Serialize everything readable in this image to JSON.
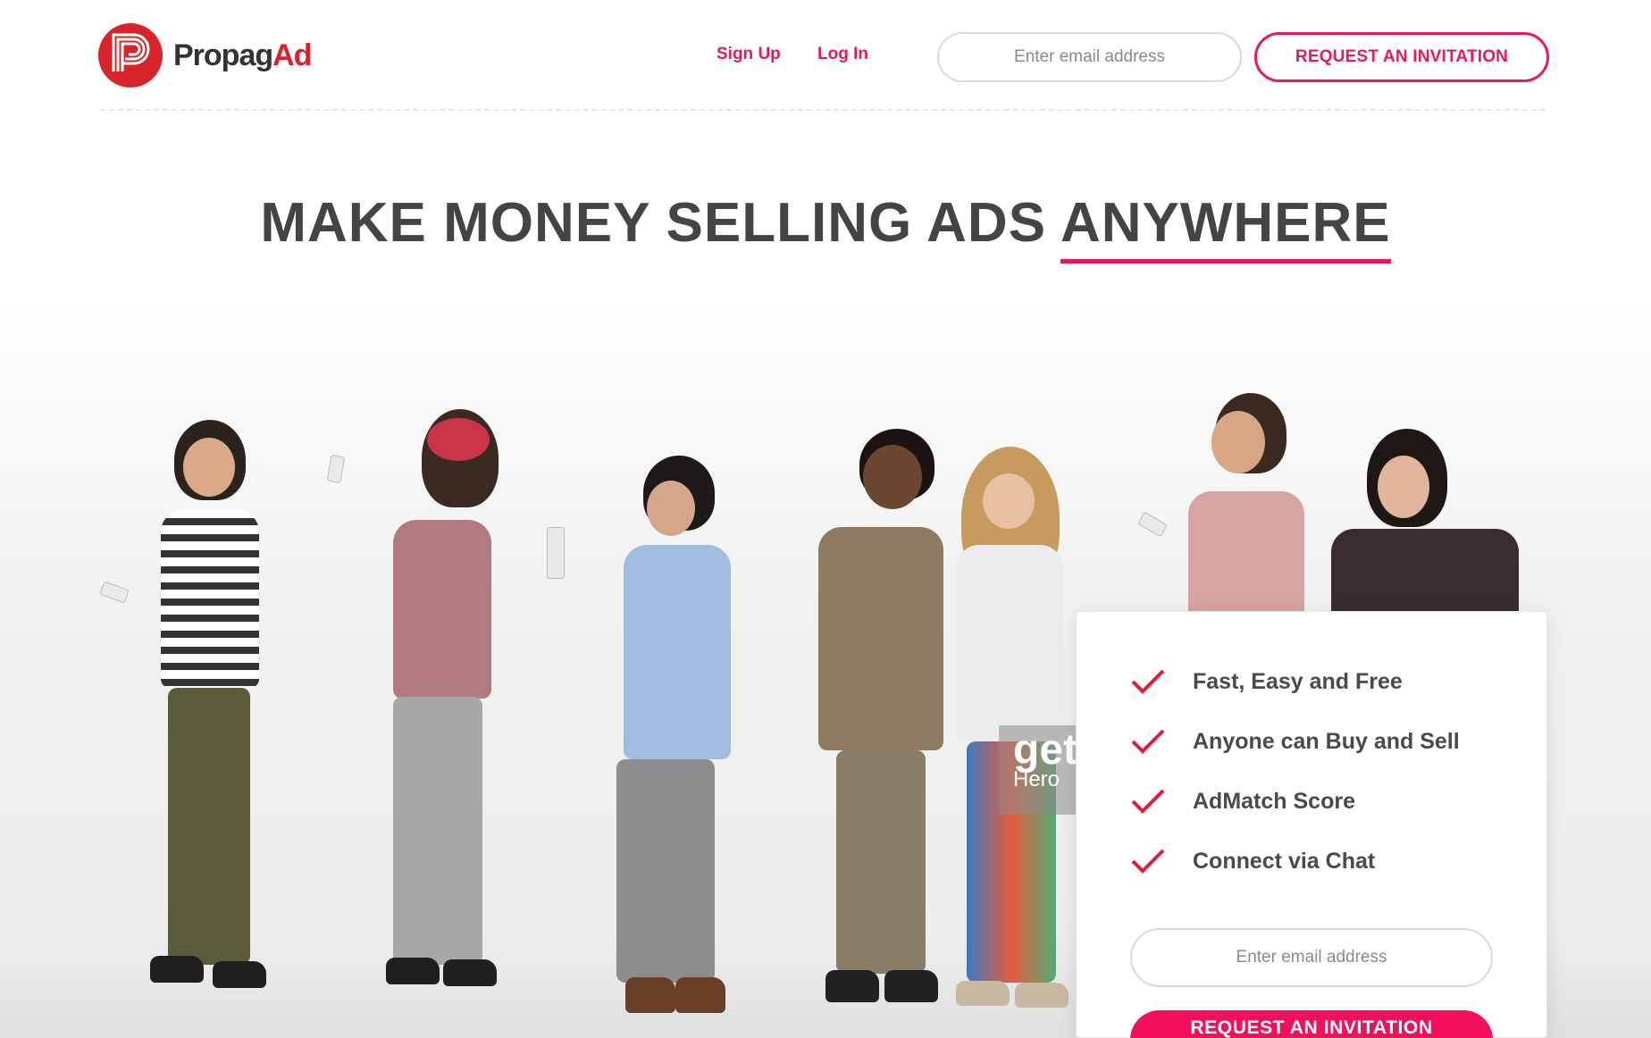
{
  "brand": {
    "name_main": "Propag",
    "name_accent": "Ad",
    "logo_icon": "propagad-p-logo-icon",
    "accent_color": "#e5195f",
    "logo_color": "#d8232a"
  },
  "nav": {
    "signup_label": "Sign Up",
    "login_label": "Log In",
    "email_placeholder": "Enter email address",
    "cta_label": "REQUEST AN INVITATION"
  },
  "headline": {
    "text": "MAKE MONEY SELLING ADS ",
    "emphasis": "ANYWHERE"
  },
  "hero": {
    "watermark_main": "get",
    "watermark_sub": "Hero"
  },
  "card": {
    "features": [
      {
        "label": "Fast, Easy and Free",
        "icon": "checkmark-icon"
      },
      {
        "label": "Anyone can Buy and Sell",
        "icon": "checkmark-icon"
      },
      {
        "label": "AdMatch Score",
        "icon": "checkmark-icon"
      },
      {
        "label": "Connect via Chat",
        "icon": "checkmark-icon"
      }
    ],
    "email_placeholder": "Enter email address",
    "cta_label": "REQUEST AN INVITATION"
  }
}
